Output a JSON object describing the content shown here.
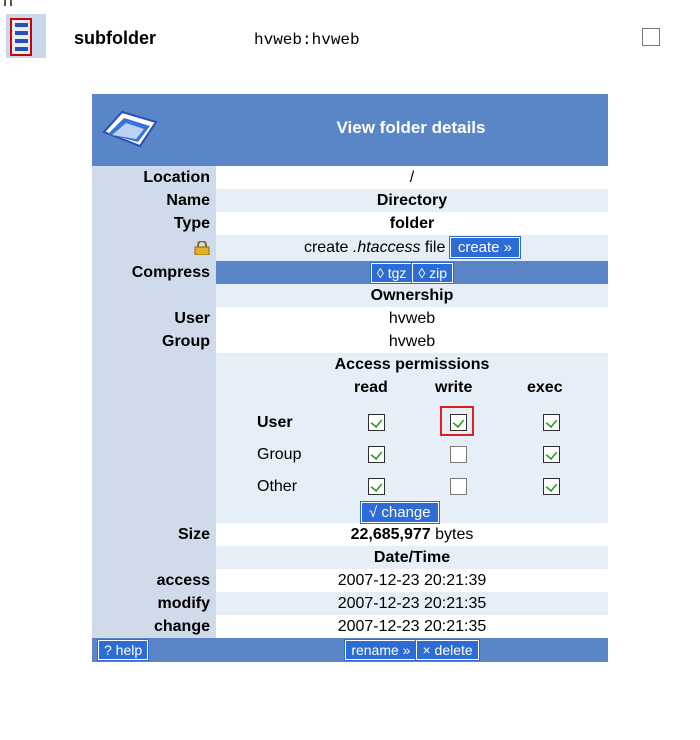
{
  "listing": {
    "item_name": "subfolder",
    "item_owner": "hvweb:hvweb"
  },
  "panel": {
    "title": "View folder details",
    "rows": {
      "location": {
        "label": "Location",
        "value": "/"
      },
      "name": {
        "label": "Name",
        "value": "Directory"
      },
      "type": {
        "label": "Type",
        "value": "folder"
      },
      "htaccess": {
        "prefix": "create",
        "file": ".htaccess",
        "suffix": "file",
        "button": "create »"
      },
      "compress": {
        "label": "Compress",
        "tgz": "◊ tgz",
        "zip": "◊ zip"
      },
      "ownership": {
        "heading": "Ownership"
      },
      "user": {
        "label": "User",
        "value": "hvweb"
      },
      "group": {
        "label": "Group",
        "value": "hvweb"
      },
      "permissions": {
        "heading": "Access permissions",
        "columns": [
          "read",
          "write",
          "exec"
        ],
        "rows": [
          {
            "label": "User",
            "read": true,
            "write": true,
            "exec": true
          },
          {
            "label": "Group",
            "read": true,
            "write": false,
            "exec": true
          },
          {
            "label": "Other",
            "read": true,
            "write": false,
            "exec": true
          }
        ],
        "change_button": "√ change"
      },
      "size": {
        "label": "Size",
        "number": "22,685,977",
        "unit": "bytes"
      },
      "datetime": {
        "heading": "Date/Time"
      },
      "access": {
        "label": "access",
        "value": "2007-12-23 20:21:39"
      },
      "modify": {
        "label": "modify",
        "value": "2007-12-23 20:21:35"
      },
      "change": {
        "label": "change",
        "value": "2007-12-23 20:21:35"
      }
    },
    "footer": {
      "help": "? help",
      "rename": "rename »",
      "delete": "× delete"
    }
  },
  "colors": {
    "header_blue": "#5a86c8",
    "label_bg": "#cfdaea",
    "tint_bg": "#e6eef8",
    "button_blue": "#2d6bd6",
    "highlight_red": "#e02020"
  },
  "icons": [
    "folder-list-icon",
    "folder-details-icon",
    "lock-icon"
  ]
}
